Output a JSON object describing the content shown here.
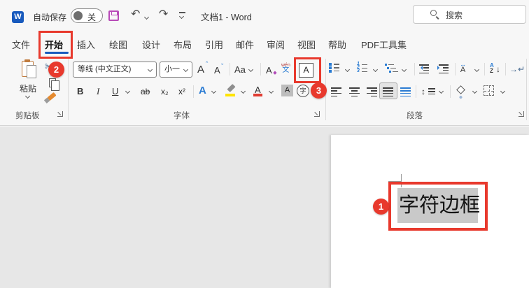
{
  "titlebar": {
    "logo_letter": "W",
    "autosave_label": "自动保存",
    "autosave_state": "关",
    "undo_glyph": "↶",
    "redo_glyph": "↷",
    "doc_title": "文档1 - Word",
    "search_placeholder": "搜索"
  },
  "tabs": [
    {
      "label": "文件"
    },
    {
      "label": "开始",
      "active": true
    },
    {
      "label": "插入"
    },
    {
      "label": "绘图"
    },
    {
      "label": "设计"
    },
    {
      "label": "布局"
    },
    {
      "label": "引用"
    },
    {
      "label": "邮件"
    },
    {
      "label": "审阅"
    },
    {
      "label": "视图"
    },
    {
      "label": "帮助"
    },
    {
      "label": "PDF工具集"
    }
  ],
  "ribbon": {
    "clipboard": {
      "paste_label": "粘贴",
      "scissors_glyph": "✂",
      "group_label": "剪贴板"
    },
    "font": {
      "font_name_value": "等线 (中文正文)",
      "font_size_value": "小一",
      "grow_font": "A",
      "shrink_font": "A",
      "change_case": "Aa",
      "clear_format": "A",
      "phonetic_top": "wén",
      "phonetic_bottom": "文",
      "char_border": "A",
      "bold": "B",
      "italic": "I",
      "underline": "U",
      "strikethrough": "ab",
      "subscript": "x₂",
      "superscript": "x²",
      "text_effects": "A",
      "font_color": "A",
      "char_shading": "A",
      "enclose_char": "字",
      "group_label": "字体"
    },
    "paragraph": {
      "asian_layout_letter": "A",
      "asian_layout_arrows": "↔",
      "sort_a": "A",
      "sort_z": "Z",
      "sort_arrow": "↓",
      "show_marks": "→↵",
      "line_spacing_arrow": "↕",
      "group_label": "段落"
    }
  },
  "document": {
    "selected_text": "字符边框"
  },
  "annotations": [
    {
      "number": "1"
    },
    {
      "number": "2"
    },
    {
      "number": "3"
    }
  ],
  "colors": {
    "accent_blue": "#185abd",
    "icon_blue": "#2b7cd3",
    "annotation_red": "#e8392d",
    "selection_gray": "#c9c9c9",
    "highlight_yellow": "#ffe400",
    "font_color_red": "#e03c32",
    "save_magenta": "#b84ab8"
  }
}
